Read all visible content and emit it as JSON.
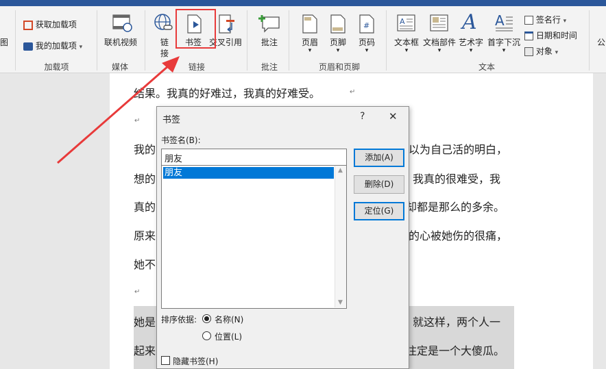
{
  "ribbon": {
    "left_cut_label": "图",
    "addins": {
      "get_addins": "获取加载项",
      "my_addins": "我的加载项",
      "group": "加载项"
    },
    "media": {
      "online_video": "联机视频",
      "group": "媒体"
    },
    "links": {
      "link_line1": "链",
      "link_line2": "接",
      "bookmark": "书签",
      "cross_reference": "交叉引用",
      "group": "链接"
    },
    "comments": {
      "comment": "批注",
      "group": "批注"
    },
    "header_footer": {
      "header": "页眉",
      "footer": "页脚",
      "page_number": "页码",
      "group": "页眉和页脚"
    },
    "text": {
      "text_box": "文本框",
      "quick_parts": "文档部件",
      "wordart": "艺术字",
      "drop_cap": "首字下沉",
      "signature_line": "签名行",
      "date_time": "日期和时间",
      "object": "对象",
      "group": "文本"
    },
    "right_cut_label": "公"
  },
  "document": {
    "line1": "结果。我真的好难过，我真的好难受。",
    "line3_left": "我的",
    "line3_right": "以为自己活的明白，",
    "line4_left": "想的",
    "line4_right": "我真的很难受，我",
    "line5_left": "真的",
    "line5_right": "却都是那么的多余。",
    "line6_left": "原来",
    "line6_right": "的心被她伤的很痛，",
    "line7_left": "她不",
    "line8_left": "她是",
    "line8_right": "就这样，两个人一",
    "line9_left": "起来",
    "line9_right": "注定是一个大傻瓜。",
    "para_mark": "↵"
  },
  "dialog": {
    "title": "书签",
    "help": "?",
    "close": "✕",
    "name_label": "书签名(B):",
    "name_value": "朋友",
    "bookmarks": [
      "朋友"
    ],
    "add_button": "添加(A)",
    "delete_button": "删除(D)",
    "goto_button": "定位(G)",
    "sort_label": "排序依据:",
    "sort_name": "名称(N)",
    "sort_location": "位置(L)",
    "hidden_bookmarks": "隐藏书签(H)"
  },
  "colors": {
    "accent": "#0078d7",
    "annotation": "#e83a3a",
    "ribbon": "#f3f3f3",
    "title_bar": "#2b579a"
  }
}
